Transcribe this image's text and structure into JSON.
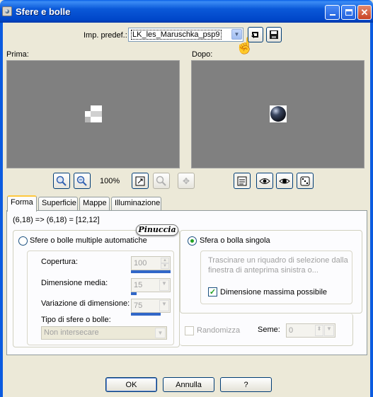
{
  "window": {
    "title": "Sfere e bolle"
  },
  "preset": {
    "label": "Imp. predef.:",
    "value": "LK_les_Maruschka_psp9"
  },
  "preview": {
    "before_label": "Prima:",
    "after_label": "Dopo:",
    "zoom": "100%"
  },
  "tabs": [
    {
      "label": "Forma"
    },
    {
      "label": "Superficie"
    },
    {
      "label": "Mappe"
    },
    {
      "label": "Illuminazione"
    }
  ],
  "coords_text": "(6,18) => (6,18) = [12,12]",
  "watermark_badge": "Pinuccia",
  "multi": {
    "radio_label": "Sfere o bolle multiple automatiche",
    "coverage_label": "Copertura:",
    "coverage_value": "100",
    "avg_size_label": "Dimensione media:",
    "avg_size_value": "15",
    "size_variation_label": "Variazione di dimensione:",
    "size_variation_value": "75",
    "type_label": "Tipo di sfere o bolle:",
    "type_value": "Non intersecare",
    "randomize_label": "Randomizza",
    "seed_label": "Seme:",
    "seed_value": "0"
  },
  "single": {
    "radio_label": "Sfera o bolla singola",
    "hint_text_1": "Trascinare un riquadro di selezione dalla",
    "hint_text_2": "finestra di anteprima sinistra o...",
    "max_size_label": "Dimensione massima possibile"
  },
  "buttons": {
    "ok": "OK",
    "cancel": "Annulla",
    "help": "?"
  },
  "colors": {
    "titlebar": "#0a58d8",
    "dialog_bg": "#ece9d8",
    "preview_bg": "#808080",
    "tab_accent": "#ffc83c"
  }
}
